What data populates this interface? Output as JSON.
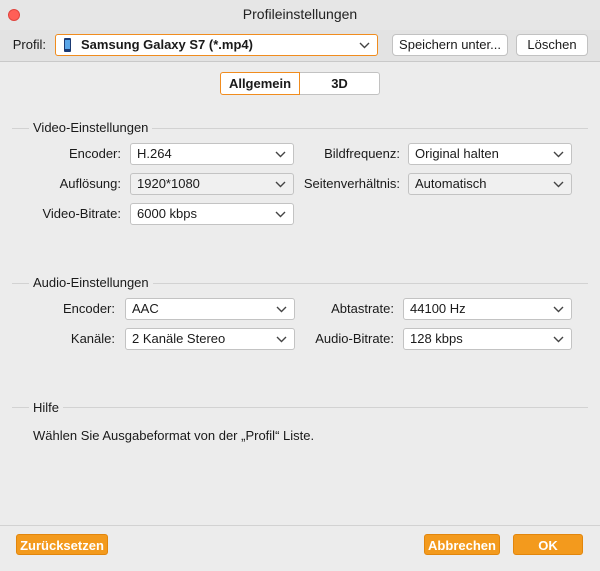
{
  "window": {
    "title": "Profileinstellungen"
  },
  "toolbar": {
    "profile_label": "Profil:",
    "profile_value": "Samsung Galaxy S7 (*.mp4)",
    "save_as_label": "Speichern unter...",
    "delete_label": "Löschen"
  },
  "tabs": {
    "general": "Allgemein",
    "three_d": "3D"
  },
  "video": {
    "section_title": "Video-Einstellungen",
    "encoder_label": "Encoder:",
    "encoder_value": "H.264",
    "framerate_label": "Bildfrequenz:",
    "framerate_value": "Original halten",
    "resolution_label": "Auflösung:",
    "resolution_value": "1920*1080",
    "aspect_label": "Seitenverhältnis:",
    "aspect_value": "Automatisch",
    "bitrate_label": "Video-Bitrate:",
    "bitrate_value": "6000 kbps"
  },
  "audio": {
    "section_title": "Audio-Einstellungen",
    "encoder_label": "Encoder:",
    "encoder_value": "AAC",
    "samplerate_label": "Abtastrate:",
    "samplerate_value": "44100 Hz",
    "channels_label": "Kanäle:",
    "channels_value": "2 Kanäle Stereo",
    "bitrate_label": "Audio-Bitrate:",
    "bitrate_value": "128 kbps"
  },
  "help": {
    "section_title": "Hilfe",
    "text": "Wählen Sie Ausgabeformat von der „Profil“ Liste."
  },
  "footer": {
    "reset_label": "Zurücksetzen",
    "cancel_label": "Abbrechen",
    "ok_label": "OK"
  },
  "colors": {
    "accent": "#f39a1d",
    "accent_border": "#f08c1e",
    "close": "#ff5f57"
  },
  "icons": {
    "close": "close-icon",
    "chevron": "chevron-down-icon",
    "phone": "phone-icon"
  }
}
